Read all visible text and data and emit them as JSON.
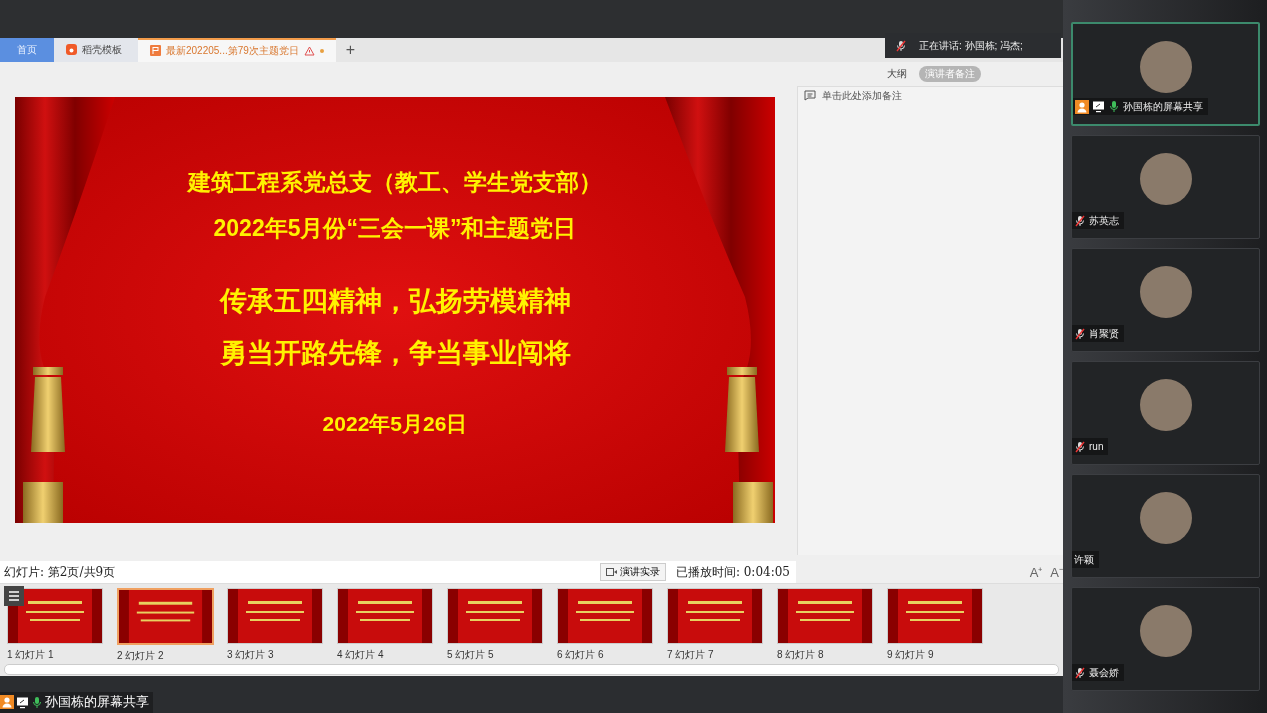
{
  "tabs": [
    {
      "label": "首页",
      "kind": "home",
      "selected": false
    },
    {
      "label": "稻壳模板",
      "kind": "docer",
      "selected": false
    },
    {
      "label": "最新202205...第79次主题党日",
      "kind": "doc",
      "selected": true
    }
  ],
  "new_tab": "+",
  "speaking": {
    "text": "正在讲话: 孙国栋; 冯杰;"
  },
  "slide": {
    "lines": [
      {
        "text": "建筑工程系党总支（教工、学生党支部）",
        "kind": "title"
      },
      {
        "text": "2022年5月份“三会一课”和主题党日",
        "kind": "title"
      },
      {
        "text": "传承五四精神，弘扬劳模精神",
        "kind": "motto"
      },
      {
        "text": "勇当开路先锋，争当事业闯将",
        "kind": "motto"
      },
      {
        "text": "2022年5月26日",
        "kind": "date"
      }
    ]
  },
  "notes": {
    "tabs": [
      {
        "label": "大纲",
        "selected": false
      },
      {
        "label": "演讲者备注",
        "selected": true
      }
    ],
    "placeholder": "单击此处添加备注"
  },
  "status": {
    "page": "幻灯片: 第2页/共9页",
    "record_button": "演讲实录",
    "elapsed": "已播放时间: 0:04:05",
    "font_up": "A⁺",
    "font_down": "A⁻"
  },
  "thumbnails": [
    {
      "label": "1 幻灯片 1",
      "selected": false
    },
    {
      "label": "2 幻灯片 2",
      "selected": true
    },
    {
      "label": "3 幻灯片 3",
      "selected": false
    },
    {
      "label": "4 幻灯片 4",
      "selected": false
    },
    {
      "label": "5 幻灯片 5",
      "selected": false
    },
    {
      "label": "6 幻灯片 6",
      "selected": false
    },
    {
      "label": "7 幻灯片 7",
      "selected": false
    },
    {
      "label": "8 幻灯片 8",
      "selected": false
    },
    {
      "label": "9 幻灯片 9",
      "selected": false
    }
  ],
  "share_label": "孙国栋的屏幕共享",
  "participants": [
    {
      "name": "孙国栋的屏幕共享",
      "kind": "live",
      "sharing": true,
      "selected": true
    },
    {
      "name": "苏英志",
      "kind": "muted",
      "sharing": false,
      "selected": false
    },
    {
      "name": "肖聚贤",
      "kind": "muted",
      "sharing": false,
      "selected": false
    },
    {
      "name": "run",
      "kind": "muted",
      "sharing": false,
      "selected": false
    },
    {
      "name": "许颖",
      "kind": "plain",
      "sharing": false,
      "selected": false
    },
    {
      "name": "聂会娇",
      "kind": "muted",
      "sharing": false,
      "selected": false
    }
  ]
}
